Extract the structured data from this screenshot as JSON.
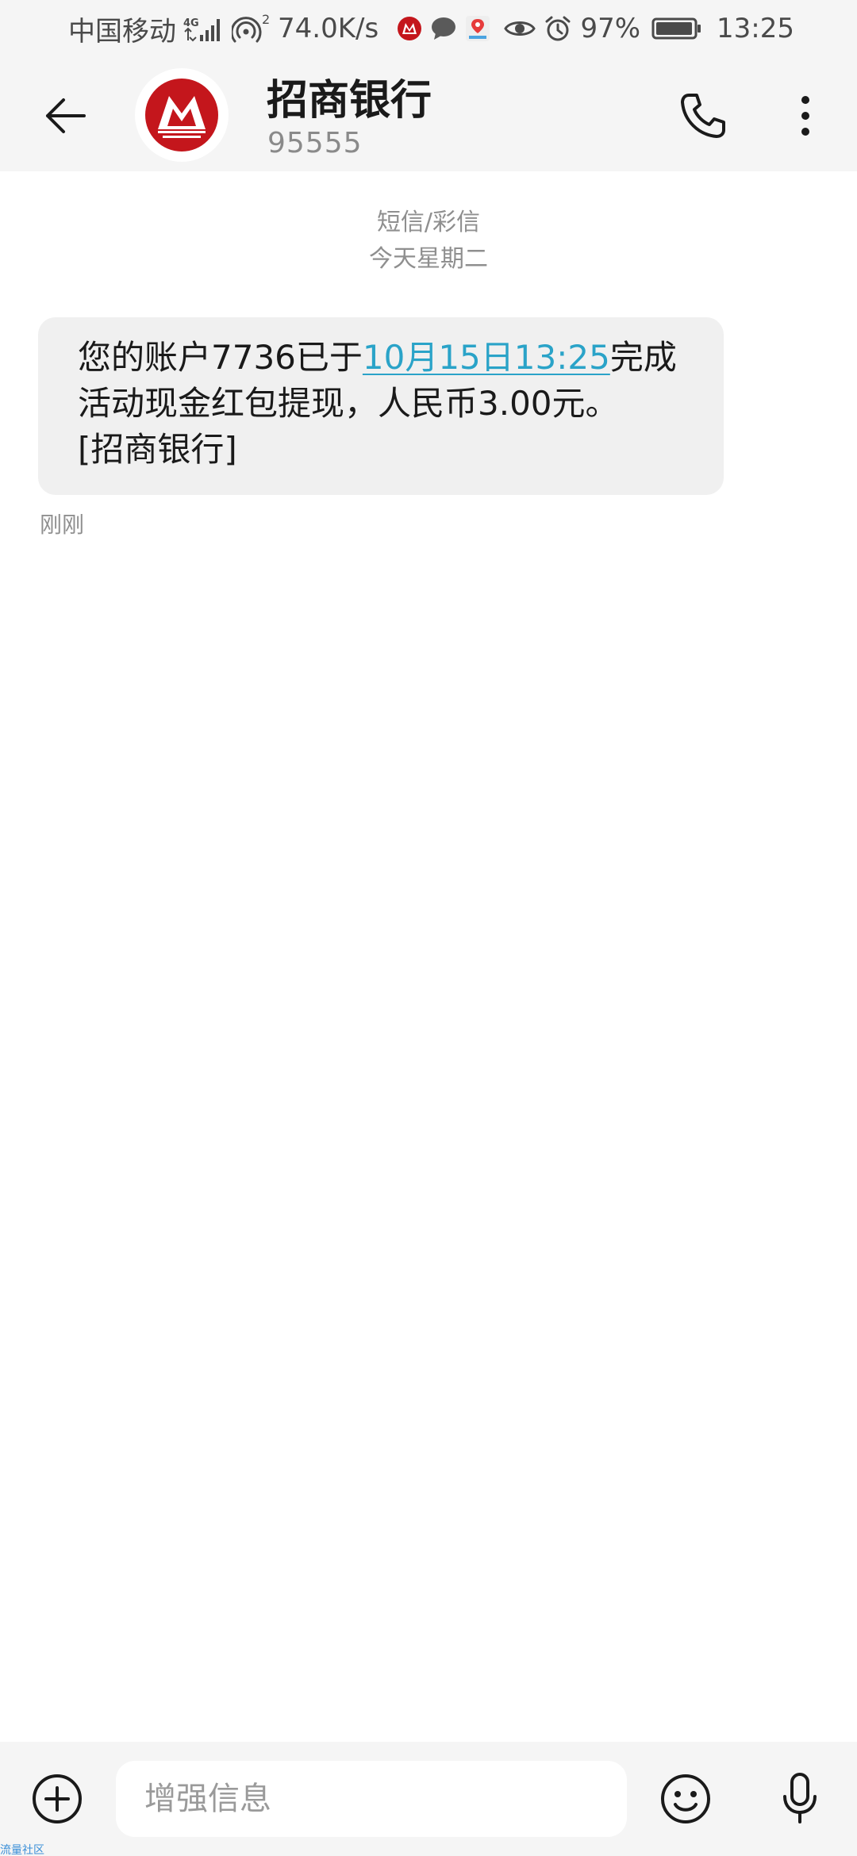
{
  "status_bar": {
    "carrier": "中国移动",
    "network_type": "4G",
    "hotspot_count": "2",
    "speed": "74.0K/s",
    "battery": "97%",
    "time": "13:25",
    "icons": [
      "cmb-notification-icon",
      "chat-notification-icon",
      "location-notification-icon",
      "eye-icon",
      "alarm-icon",
      "battery-icon"
    ]
  },
  "header": {
    "contact_name": "招商银行",
    "contact_number": "95555",
    "brand_color": "#c4161c",
    "icons": [
      "back-arrow-icon",
      "cmb-logo",
      "phone-icon",
      "more-vert-icon"
    ]
  },
  "conversation": {
    "type_label": "短信/彩信",
    "date_label": "今天星期二",
    "messages": [
      {
        "text_before_link": "您的账户7736已于",
        "link_text": "10月15日13:25",
        "text_after_link": "完成",
        "line2": "活动现金红包提现，人民币3.00元。",
        "line3": "[招商银行]",
        "time": "刚刚",
        "link_color": "#2aa3c8"
      }
    ]
  },
  "input_bar": {
    "placeholder": "增强信息",
    "value": "",
    "icons": [
      "add-circle-icon",
      "emoji-icon",
      "microphone-icon"
    ]
  },
  "watermark": "流量社区"
}
